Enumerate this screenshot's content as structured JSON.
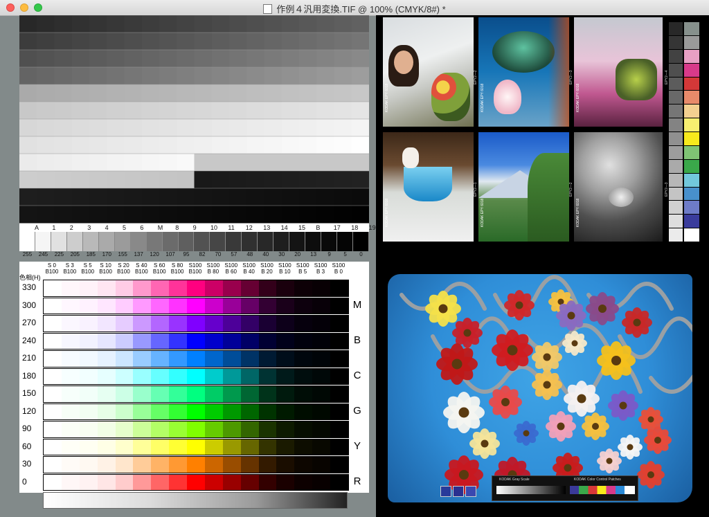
{
  "window": {
    "title": "作例４汎用変換.TIF @ 100% (CMYK/8#) *"
  },
  "top_chart": {
    "column_labels": [
      "A",
      "1",
      "2",
      "3",
      "4",
      "5",
      "6",
      "M",
      "8",
      "9",
      "10",
      "11",
      "12",
      "13",
      "14",
      "15",
      "B",
      "17",
      "18",
      "19"
    ]
  },
  "gray_scale": {
    "values": [
      "255",
      "245",
      "225",
      "205",
      "185",
      "170",
      "155",
      "137",
      "120",
      "107",
      "95",
      "82",
      "70",
      "57",
      "48",
      "40",
      "30",
      "20",
      "13",
      "9",
      "5",
      "0"
    ]
  },
  "hue_chart": {
    "corner_label": "色相(H)",
    "columns": [
      {
        "top": "S 0",
        "bottom": "B100"
      },
      {
        "top": "S 3",
        "bottom": "B100"
      },
      {
        "top": "S 5",
        "bottom": "B100"
      },
      {
        "top": "S 10",
        "bottom": "B100"
      },
      {
        "top": "S 20",
        "bottom": "B100"
      },
      {
        "top": "S 40",
        "bottom": "B100"
      },
      {
        "top": "S 60",
        "bottom": "B100"
      },
      {
        "top": "S 80",
        "bottom": "B100"
      },
      {
        "top": "S100",
        "bottom": "B100"
      },
      {
        "top": "S100",
        "bottom": "B 80"
      },
      {
        "top": "S100",
        "bottom": "B 60"
      },
      {
        "top": "S100",
        "bottom": "B 40"
      },
      {
        "top": "S100",
        "bottom": "B 20"
      },
      {
        "top": "S100",
        "bottom": "B 10"
      },
      {
        "top": "S100",
        "bottom": "B 5"
      },
      {
        "top": "S100",
        "bottom": "B 3"
      },
      {
        "top": "S100",
        "bottom": "B 0"
      }
    ],
    "rows": [
      {
        "hue": "330",
        "side": ""
      },
      {
        "hue": "300",
        "side": "M"
      },
      {
        "hue": "270",
        "side": ""
      },
      {
        "hue": "240",
        "side": "B"
      },
      {
        "hue": "210",
        "side": ""
      },
      {
        "hue": "180",
        "side": "C"
      },
      {
        "hue": "150",
        "side": ""
      },
      {
        "hue": "120",
        "side": "G"
      },
      {
        "hue": "90",
        "side": ""
      },
      {
        "hue": "60",
        "side": "Y"
      },
      {
        "hue": "30",
        "side": ""
      },
      {
        "hue": "0",
        "side": "R"
      }
    ]
  },
  "photo_grid": {
    "captions": [
      "KODAK EPY 6018",
      "KODAK EPY 6018",
      "KODAK EPY 6018",
      "KODAK EPY 6018",
      "KODAK EPY 6018",
      "KODAK EPY 6018"
    ],
    "frame_marks": [
      "EPY2—2",
      "EPY2—3",
      "EPY2—4",
      "EPY2—1",
      "EPY2—2",
      "EPY2—3"
    ]
  },
  "side_strip": {
    "marks": [
      "EPY2—5",
      "EPY2—5"
    ],
    "patch_colors": [
      "#86908c",
      "#9a9a9a",
      "#e8a0c4",
      "#d83a8a",
      "#d43838",
      "#e88a6a",
      "#f3d090",
      "#f7ef70",
      "#f7ea1c",
      "#7fc474",
      "#3aa84a",
      "#72c8dc",
      "#4890cc",
      "#6e7cc8",
      "#3a3c9c",
      "#ffffff"
    ]
  },
  "flower_photo": {
    "grayscale_label": "KODAK Gray Scale",
    "color_label": "KODAK Color Control Patches"
  }
}
